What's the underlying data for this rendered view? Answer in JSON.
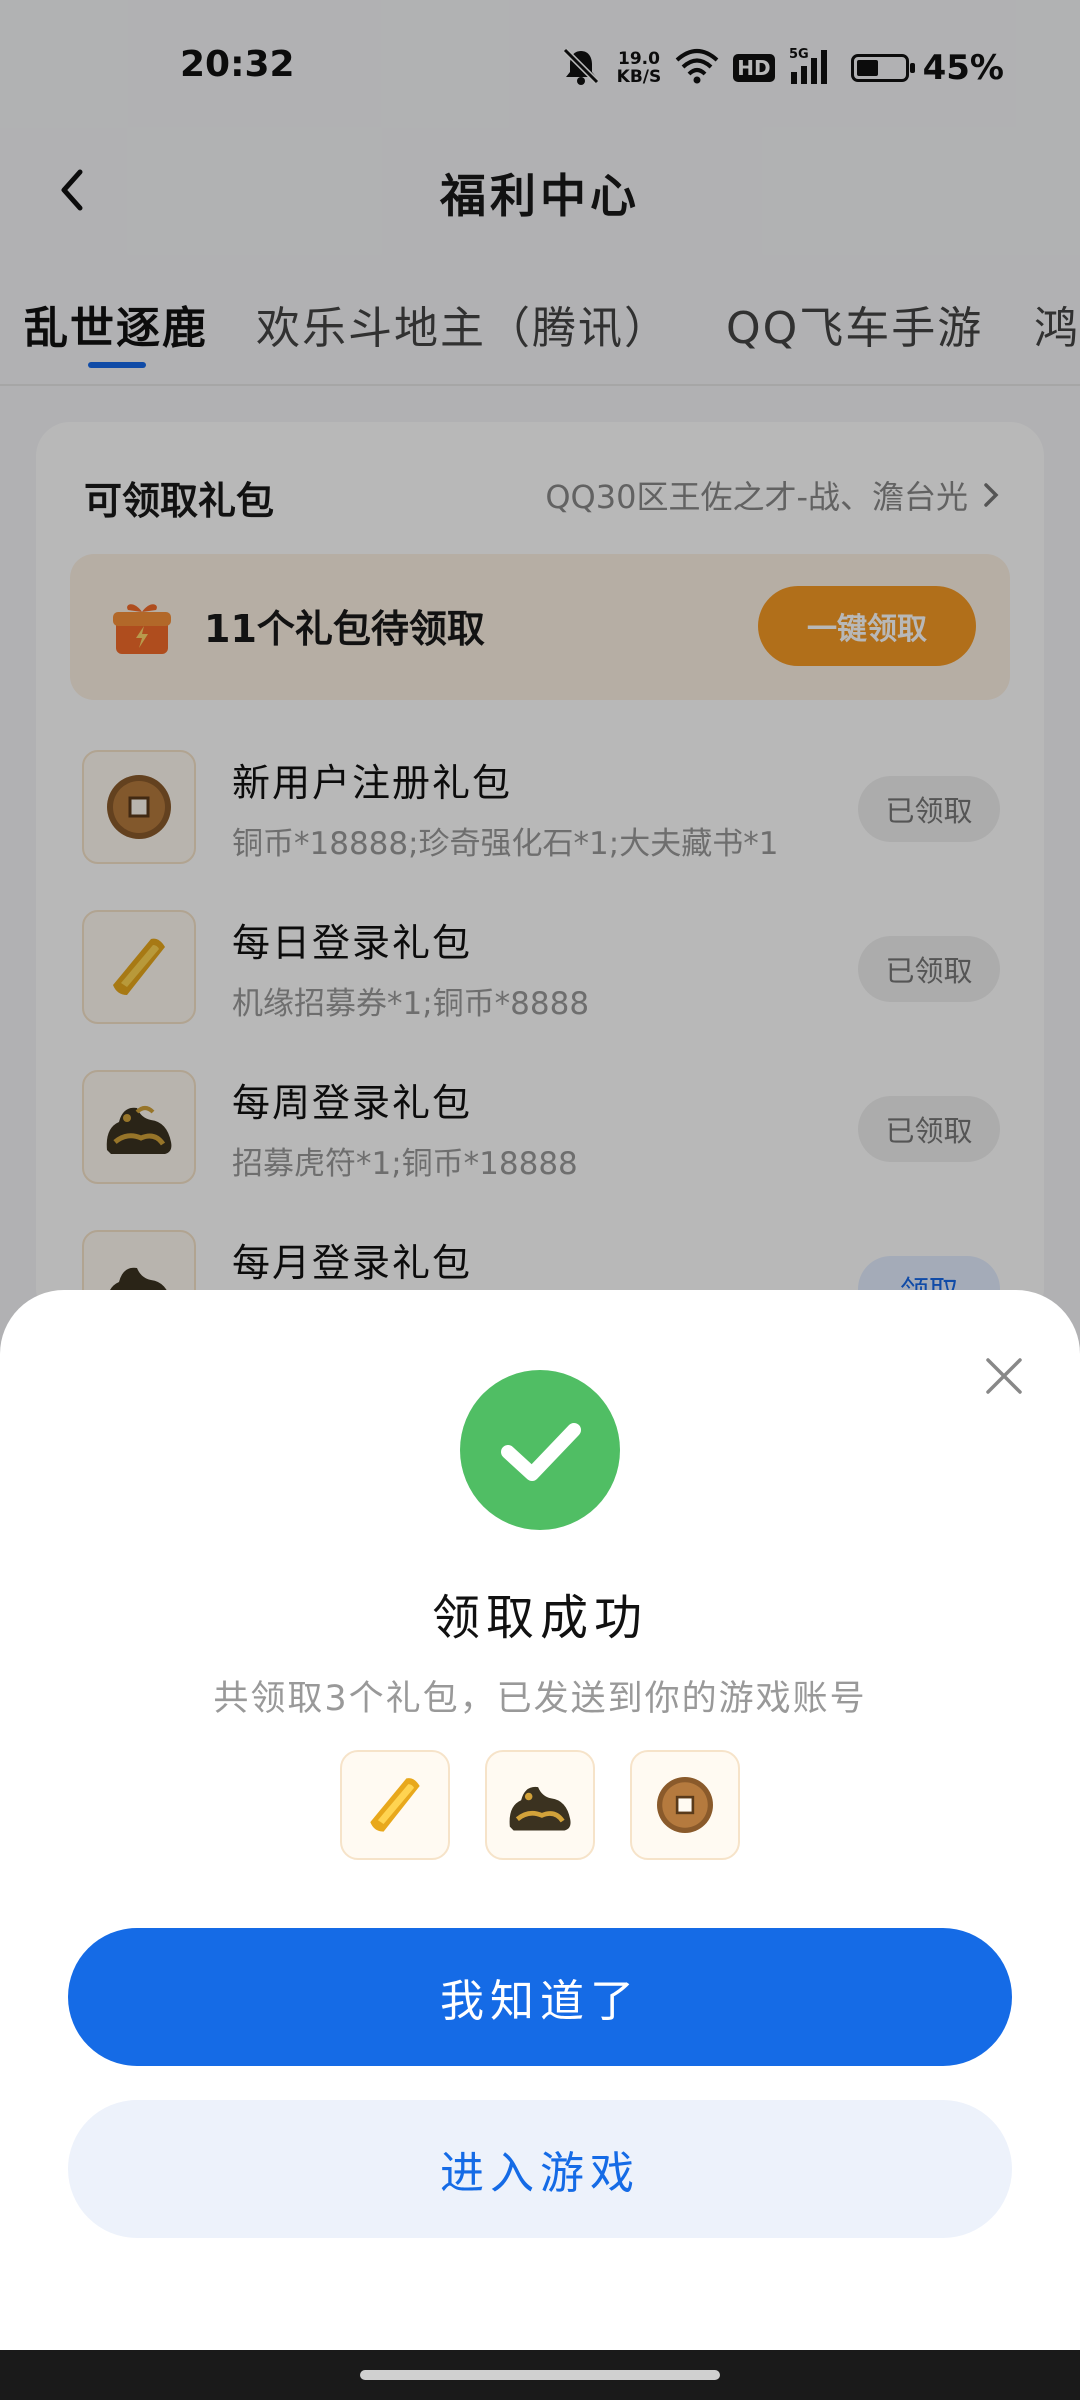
{
  "status_bar": {
    "time": "20:32",
    "net_speed_value": "19.0",
    "net_speed_unit": "KB/S",
    "hd": "HD",
    "signal": "5G",
    "battery_text": "45%",
    "battery_level": 0.45,
    "icons": [
      "mute-bell-icon",
      "wifi-icon",
      "hd-icon",
      "signal-icon",
      "battery-icon"
    ]
  },
  "header": {
    "title": "福利中心",
    "back_icon": "chevron-left-icon"
  },
  "tabs": [
    {
      "label": "乱世逐鹿",
      "active": true
    },
    {
      "label": "欢乐斗地主（腾讯）",
      "active": false
    },
    {
      "label": "QQ飞车手游",
      "active": false
    },
    {
      "label": "鸿",
      "active": false
    }
  ],
  "gift_section": {
    "title": "可领取礼包",
    "server": "QQ30区王佐之才-战、澹台光",
    "pending_text": "11个礼包待领取",
    "claim_all_label": "一键领取",
    "items": [
      {
        "name": "新用户注册礼包",
        "desc": "铜币*18888;珍奇强化石*1;大夫藏书*1",
        "button": "已领取",
        "icon": "copper-coin-icon"
      },
      {
        "name": "每日登录礼包",
        "desc": "机缘招募券*1;铜币*8888",
        "button": "已领取",
        "icon": "gold-ticket-icon"
      },
      {
        "name": "每周登录礼包",
        "desc": "招募虎符*1;铜币*18888",
        "button": "已领取",
        "icon": "bronze-tiger-icon"
      },
      {
        "name": "每月登录礼包",
        "desc": "",
        "button": "领取",
        "icon": "bronze-tiger-icon"
      }
    ]
  },
  "success_dialog": {
    "title": "领取成功",
    "subtitle": "共领取3个礼包，已发送到你的游戏账号",
    "reward_icons": [
      "gold-ticket-icon",
      "bronze-tiger-icon",
      "copper-coin-icon"
    ],
    "primary_label": "我知道了",
    "secondary_label": "进入游戏"
  },
  "colors": {
    "accent_blue": "#156be6",
    "orange": "#f59a24",
    "success_green": "#50be64"
  }
}
